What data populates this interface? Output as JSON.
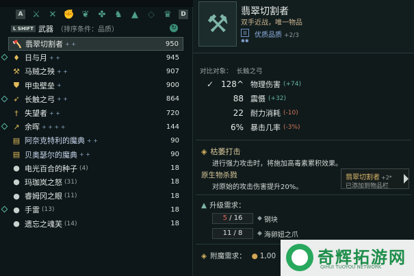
{
  "tabs": {
    "left_key": "A",
    "right_key": "D",
    "icons": [
      "weapon-class-icon",
      "crossed-tools-icon",
      "fist-icon",
      "paw-icon",
      "cluster-icon",
      "dragon-icon",
      "anvil-icon",
      "gem-icon",
      "crown-icon"
    ]
  },
  "category": {
    "shift": "L SHIFT",
    "title": "武器",
    "sort": "（排序条件：品质）"
  },
  "weapons": [
    {
      "name": "翡翠切割者",
      "tag": "+ +",
      "value": "950",
      "selected": true
    },
    {
      "name": "日与月",
      "tag": "+ +",
      "value": "945"
    },
    {
      "name": "马贼之殃",
      "tag": "+ +",
      "value": "907"
    },
    {
      "name": "甲虫壁垒",
      "tag": "+",
      "value": "900"
    },
    {
      "name": "长触之弓",
      "tag": "+ +",
      "value": "864"
    },
    {
      "name": "失望者",
      "tag": "+ +",
      "value": "720"
    },
    {
      "name": "余晖",
      "tag": "+ + + +",
      "value": "144"
    },
    {
      "name": "阿奈克特利的魔典",
      "tag": "+ +",
      "value": "90"
    },
    {
      "name": "贝奥瑟尔的魔典",
      "tag": "+ +",
      "value": "90"
    },
    {
      "name": "电光百合的种子",
      "count": "(4)",
      "value": "18"
    },
    {
      "name": "玛珈岚之怒",
      "count": "(31)",
      "value": "18"
    },
    {
      "name": "睿姆冈之眼",
      "count": "(11)",
      "value": "18"
    },
    {
      "name": "手雷",
      "count": "(13)",
      "value": "18"
    },
    {
      "name": "遗忘之魂芙",
      "count": "(14)",
      "value": "18"
    }
  ],
  "detail": {
    "title": "翡翠切割者",
    "desc": "双手近战，唯一物品",
    "quality_icon": "II",
    "quality_stars": "✱✱",
    "quality": "优质品质",
    "quality_bonus": "+2/3",
    "compare_label": "对比对象：",
    "compare_name": "长触之弓",
    "stats": [
      {
        "num": "128",
        "sup": "^",
        "label": "物理伤害",
        "delta": "(+74)",
        "dir": "up",
        "check": "✓"
      },
      {
        "num": "88",
        "label": "震慑",
        "delta": "(+32)",
        "dir": "up"
      },
      {
        "num": "22",
        "label": "耐力消耗",
        "delta": "(-10)",
        "dir": "down"
      },
      {
        "num": "6%",
        "label": "暴击几率",
        "delta": "(-3%)",
        "dir": "down"
      }
    ],
    "perk_title": "枯萎打击",
    "perk_desc": "进行强力攻击时，将施加高毒素累积效果。",
    "perk2_title": "原生物杀戮",
    "perk2_desc": "对原始的攻击伤害提升20%。",
    "upgrade_title": "升级需求：",
    "requirements": [
      {
        "have": "5",
        "need": "16",
        "name": "钢块",
        "sep": " / "
      },
      {
        "have": "11",
        "need": "8",
        "name": "海卵妞之爪",
        "sep": " / "
      }
    ],
    "enchant_label": "附魔需求：",
    "enchant_value": "1,00"
  },
  "tooltip": {
    "name": "翡翠切割者",
    "bonus": "+2*",
    "msg": "已添加到物品栏"
  },
  "watermark": {
    "text": "奇辉拓游网",
    "sub": "QIHUI TUOYOU NETWORK"
  },
  "colors": {
    "accent": "#56b3a0",
    "gold": "#d8c79a",
    "up": "#64b7a3",
    "down": "#d27559"
  }
}
